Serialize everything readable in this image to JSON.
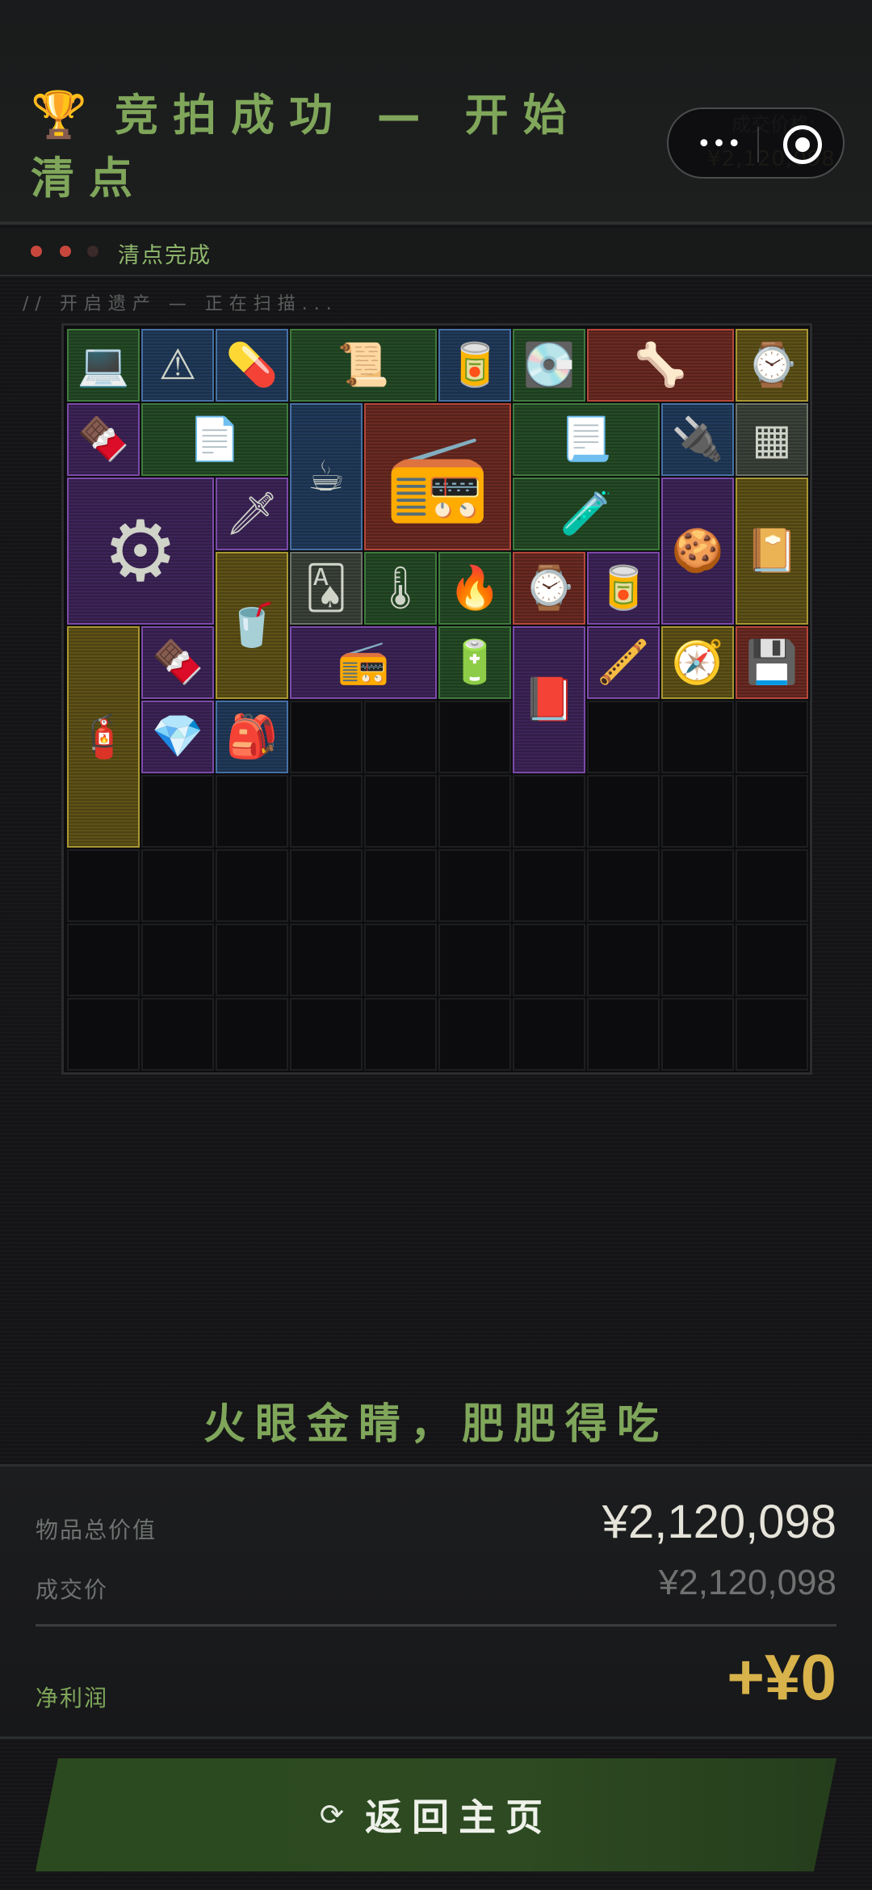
{
  "header": {
    "trophy_icon": "🏆",
    "title": "竞拍成功 — 开始清点",
    "deal_label": "成交价格:",
    "deal_value": "¥2,120,098",
    "capsule": {
      "more_icon": "•••",
      "close_icon": "target-circle-icon"
    }
  },
  "status": {
    "leds": [
      "#c8473d",
      "#c8473d",
      "#3a2a28"
    ],
    "text": "清点完成"
  },
  "scan_text": "// 开启遗产 — 正在扫描...",
  "grid": {
    "columns": 10,
    "rows": 10,
    "items": [
      {
        "name": "laptop",
        "rarity": "green",
        "col": 0,
        "row": 0,
        "w": 1,
        "h": 1,
        "glyph": "💻"
      },
      {
        "name": "warning-sign",
        "rarity": "blue",
        "col": 1,
        "row": 0,
        "w": 1,
        "h": 1,
        "glyph": "⚠"
      },
      {
        "name": "pill-bottle",
        "rarity": "blue",
        "col": 2,
        "row": 0,
        "w": 1,
        "h": 1,
        "glyph": "💊"
      },
      {
        "name": "old-map",
        "rarity": "green",
        "col": 3,
        "row": 0,
        "w": 2,
        "h": 1,
        "glyph": "📜"
      },
      {
        "name": "cola-can",
        "rarity": "blue",
        "col": 5,
        "row": 0,
        "w": 1,
        "h": 1,
        "glyph": "🥫"
      },
      {
        "name": "hard-drive",
        "rarity": "green",
        "col": 6,
        "row": 0,
        "w": 1,
        "h": 1,
        "glyph": "💽"
      },
      {
        "name": "claw",
        "rarity": "red",
        "col": 7,
        "row": 0,
        "w": 2,
        "h": 1,
        "glyph": "🦴"
      },
      {
        "name": "gold-watch-case",
        "rarity": "gold",
        "col": 9,
        "row": 0,
        "w": 1,
        "h": 1,
        "glyph": "⌚"
      },
      {
        "name": "energy-bar",
        "rarity": "purple",
        "col": 0,
        "row": 1,
        "w": 1,
        "h": 1,
        "glyph": "🍫"
      },
      {
        "name": "document",
        "rarity": "green",
        "col": 1,
        "row": 1,
        "w": 2,
        "h": 1,
        "glyph": "📄"
      },
      {
        "name": "moka-pot",
        "rarity": "blue",
        "col": 3,
        "row": 1,
        "w": 1,
        "h": 2,
        "glyph": "☕"
      },
      {
        "name": "retro-radio",
        "rarity": "red",
        "col": 4,
        "row": 1,
        "w": 2,
        "h": 2,
        "glyph": "📻"
      },
      {
        "name": "note-paper",
        "rarity": "green",
        "col": 6,
        "row": 1,
        "w": 2,
        "h": 1,
        "glyph": "📃"
      },
      {
        "name": "power-adapter",
        "rarity": "blue",
        "col": 8,
        "row": 1,
        "w": 1,
        "h": 1,
        "glyph": "🔌"
      },
      {
        "name": "ram-tray",
        "rarity": "gray",
        "col": 9,
        "row": 1,
        "w": 1,
        "h": 1,
        "glyph": "▦"
      },
      {
        "name": "incubator",
        "rarity": "purple",
        "col": 0,
        "row": 2,
        "w": 2,
        "h": 2,
        "glyph": "⚙"
      },
      {
        "name": "spear-tip",
        "rarity": "purple",
        "col": 2,
        "row": 2,
        "w": 1,
        "h": 1,
        "glyph": "🗡"
      },
      {
        "name": "glass-tube",
        "rarity": "green",
        "col": 6,
        "row": 2,
        "w": 2,
        "h": 1,
        "glyph": "🧪"
      },
      {
        "name": "gingerbread-man",
        "rarity": "purple",
        "col": 8,
        "row": 2,
        "w": 1,
        "h": 2,
        "glyph": "🍪"
      },
      {
        "name": "leather-journal",
        "rarity": "gold",
        "col": 9,
        "row": 2,
        "w": 1,
        "h": 2,
        "glyph": "📔"
      },
      {
        "name": "blender",
        "rarity": "gold",
        "col": 2,
        "row": 3,
        "w": 1,
        "h": 2,
        "glyph": "🥤"
      },
      {
        "name": "playing-card",
        "rarity": "gray",
        "col": 3,
        "row": 3,
        "w": 1,
        "h": 1,
        "glyph": "🂡"
      },
      {
        "name": "thermometer",
        "rarity": "green",
        "col": 4,
        "row": 3,
        "w": 1,
        "h": 1,
        "glyph": "🌡"
      },
      {
        "name": "lighter",
        "rarity": "green",
        "col": 5,
        "row": 3,
        "w": 1,
        "h": 1,
        "glyph": "🔥"
      },
      {
        "name": "wristwatch",
        "rarity": "red",
        "col": 6,
        "row": 3,
        "w": 1,
        "h": 1,
        "glyph": "⌚"
      },
      {
        "name": "energy-drink",
        "rarity": "purple",
        "col": 7,
        "row": 3,
        "w": 1,
        "h": 1,
        "glyph": "🥫"
      },
      {
        "name": "oxygen-tank",
        "rarity": "gold",
        "col": 0,
        "row": 4,
        "w": 1,
        "h": 3,
        "glyph": "🧯"
      },
      {
        "name": "protein-bar",
        "rarity": "purple",
        "col": 1,
        "row": 4,
        "w": 1,
        "h": 1,
        "glyph": "🍫"
      },
      {
        "name": "boombox",
        "rarity": "purple",
        "col": 3,
        "row": 4,
        "w": 2,
        "h": 1,
        "glyph": "📻"
      },
      {
        "name": "battery",
        "rarity": "green",
        "col": 5,
        "row": 4,
        "w": 1,
        "h": 1,
        "glyph": "🔋"
      },
      {
        "name": "black-tide-book",
        "rarity": "purple",
        "col": 6,
        "row": 4,
        "w": 1,
        "h": 2,
        "glyph": "📕"
      },
      {
        "name": "flute",
        "rarity": "purple",
        "col": 7,
        "row": 4,
        "w": 1,
        "h": 1,
        "glyph": "🪈"
      },
      {
        "name": "compass",
        "rarity": "gold",
        "col": 8,
        "row": 4,
        "w": 1,
        "h": 1,
        "glyph": "🧭"
      },
      {
        "name": "usb-drive",
        "rarity": "red",
        "col": 9,
        "row": 4,
        "w": 1,
        "h": 1,
        "glyph": "💾"
      },
      {
        "name": "earrings",
        "rarity": "purple",
        "col": 1,
        "row": 5,
        "w": 1,
        "h": 1,
        "glyph": "💎"
      },
      {
        "name": "ration-pack",
        "rarity": "blue",
        "col": 2,
        "row": 5,
        "w": 1,
        "h": 1,
        "glyph": "🎒"
      }
    ]
  },
  "slogan": "火眼金睛，肥肥得吃",
  "summary": {
    "total_label": "物品总价值",
    "total_value": "¥2,120,098",
    "deal_label": "成交价",
    "deal_value": "¥2,120,098",
    "profit_label": "净利润",
    "profit_value": "+¥0"
  },
  "back_button": {
    "icon": "refresh-icon",
    "label": "返回主页"
  },
  "colors": {
    "accent_green": "#7fa65a",
    "gold": "#d8b24a",
    "value_white": "#e6e4da"
  }
}
